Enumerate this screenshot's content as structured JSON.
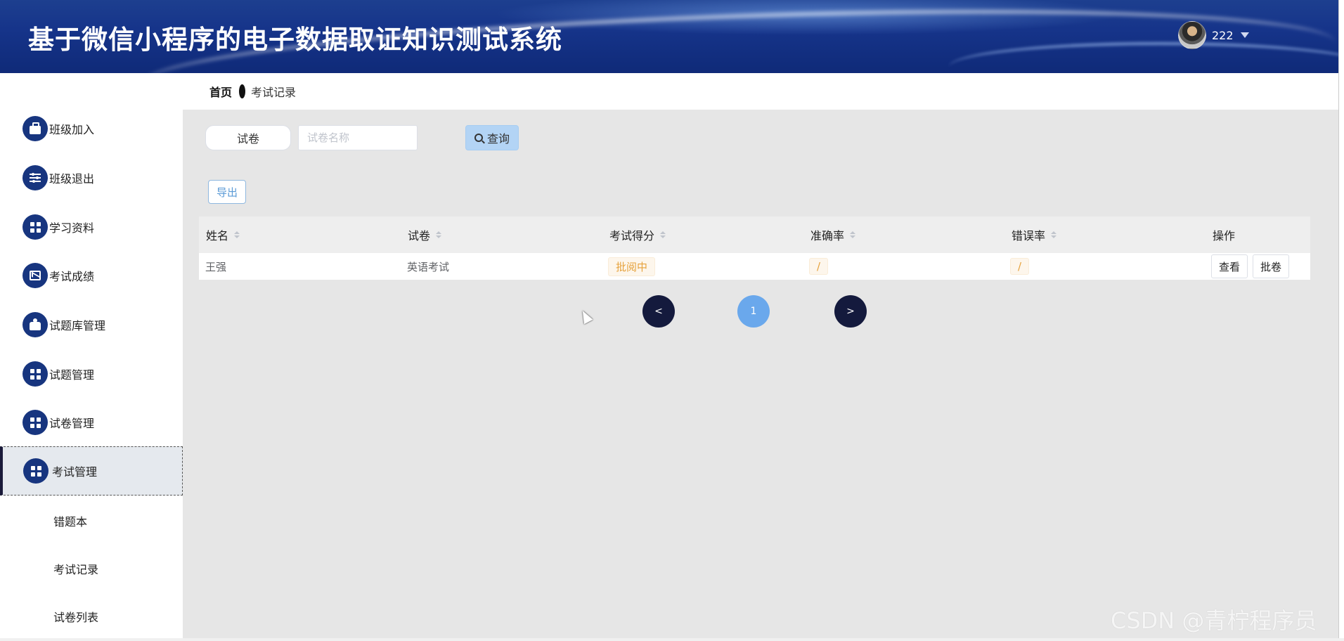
{
  "header": {
    "title": "基于微信小程序的电子数据取证知识测试系统",
    "username": "222"
  },
  "sidebar": {
    "items": [
      {
        "label": "班级加入",
        "icon": "briefcase-icon"
      },
      {
        "label": "班级退出",
        "icon": "sliders-icon"
      },
      {
        "label": "学习资料",
        "icon": "grid-icon"
      },
      {
        "label": "考试成绩",
        "icon": "chart-icon"
      },
      {
        "label": "试题库管理",
        "icon": "hand-icon"
      },
      {
        "label": "试题管理",
        "icon": "grid-icon"
      },
      {
        "label": "试卷管理",
        "icon": "grid-icon"
      },
      {
        "label": "考试管理",
        "icon": "grid-icon",
        "active": true
      }
    ],
    "subitems": [
      {
        "label": "错题本"
      },
      {
        "label": "考试记录"
      },
      {
        "label": "试卷列表"
      }
    ]
  },
  "breadcrumb": {
    "home": "首页",
    "current": "考试记录"
  },
  "search": {
    "label": "试卷",
    "placeholder": "试卷名称",
    "value": "",
    "button": "查询"
  },
  "toolbar": {
    "export": "导出"
  },
  "table": {
    "columns": [
      "姓名",
      "试卷",
      "考试得分",
      "准确率",
      "错误率",
      "操作"
    ],
    "rows": [
      {
        "name": "王强",
        "paper": "英语考试",
        "score": "批阅中",
        "accuracy": "/",
        "error_rate": "/",
        "actions": [
          "查看",
          "批卷"
        ]
      }
    ]
  },
  "pagination": {
    "prev": "<",
    "current": "1",
    "next": ">"
  },
  "watermark": "CSDN @青柠程序员",
  "colors": {
    "header_bg": "#16348a",
    "icon_bg": "#17357f",
    "tag_text": "#e6a23c",
    "page_current": "#6aa8ec",
    "page_nav": "#141a3d",
    "query_button": "#b3d4f5"
  }
}
